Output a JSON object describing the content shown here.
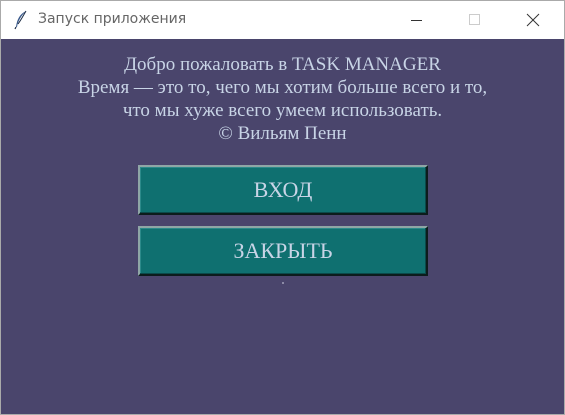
{
  "window": {
    "title": "Запуск приложения",
    "app_icon": "feather-icon",
    "controls": {
      "minimize_icon": "minimize-icon",
      "maximize_icon": "maximize-icon",
      "close_icon": "close-icon"
    }
  },
  "welcome": {
    "line1": "Добро пожаловать в TASK MANAGER",
    "line2": "Время — это то, чего мы хотим больше всего и то,",
    "line3": "что мы хуже всего умеем использовать.",
    "line4": "© Вильям Пенн"
  },
  "buttons": {
    "login_label": "ВХОД",
    "close_label": "ЗАКРЫТЬ"
  },
  "colors": {
    "background": "#4a456c",
    "button": "#0f7070",
    "text": "#c8d4e6"
  }
}
